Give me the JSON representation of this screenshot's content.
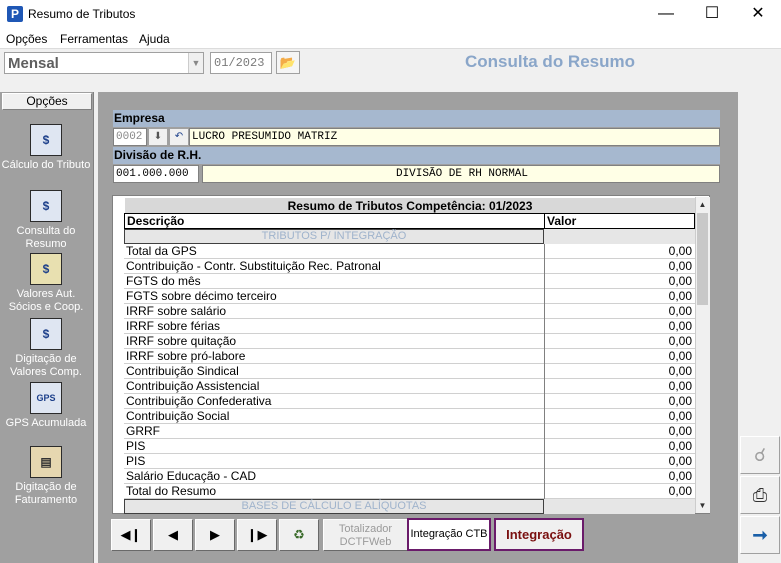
{
  "window": {
    "title": "Resumo de Tributos",
    "icon": "P"
  },
  "menu": [
    "Opções",
    "Ferramentas",
    "Ajuda"
  ],
  "toolbar": {
    "period": "Mensal",
    "competencia": "01/2023",
    "screen_title": "Consulta do Resumo"
  },
  "left_panel": {
    "header": "Opções",
    "items": [
      {
        "label": "Cálculo do Tributo",
        "icon": "calc-document-icon"
      },
      {
        "label": "Consulta do Resumo",
        "icon": "monitor-icon"
      },
      {
        "label": "Valores Aut. Sócios e Coop.",
        "icon": "people-icon"
      },
      {
        "label": "Digitação de Valores Comp.",
        "icon": "money-entry-icon"
      },
      {
        "label": "GPS Acumulada",
        "icon": "gps-icon"
      },
      {
        "label": "Digitação de Faturamento",
        "icon": "laptop-icon"
      }
    ]
  },
  "empresa": {
    "label": "Empresa",
    "code": "0002",
    "name": "LUCRO PRESUMIDO MATRIZ",
    "divisao_label": "Divisão de R.H.",
    "divisao_code": "001.000.000",
    "divisao_name": "DIVISÃO DE RH NORMAL"
  },
  "table": {
    "title": "Resumo de Tributos Competência: 01/2023",
    "col_desc": "Descrição",
    "col_valor": "Valor",
    "section1": "TRIBUTOS P/ INTEGRAÇÃO",
    "section2": "BASES DE CÁLCULO E ALÍQUOTAS",
    "rows": [
      {
        "desc": "Total da GPS",
        "valor": "0,00"
      },
      {
        "desc": "Contribuição - Contr. Substituição Rec. Patronal",
        "valor": "0,00"
      },
      {
        "desc": "FGTS do mês",
        "valor": "0,00"
      },
      {
        "desc": "FGTS sobre décimo terceiro",
        "valor": "0,00"
      },
      {
        "desc": "IRRF sobre salário",
        "valor": "0,00"
      },
      {
        "desc": "IRRF sobre férias",
        "valor": "0,00"
      },
      {
        "desc": "IRRF sobre quitação",
        "valor": "0,00"
      },
      {
        "desc": "IRRF sobre pró-labore",
        "valor": "0,00"
      },
      {
        "desc": "Contribuição Sindical",
        "valor": "0,00"
      },
      {
        "desc": "Contribuição Assistencial",
        "valor": "0,00"
      },
      {
        "desc": "Contribuição Confederativa",
        "valor": "0,00"
      },
      {
        "desc": "Contribuição Social",
        "valor": "0,00"
      },
      {
        "desc": "GRRF",
        "valor": "0,00"
      },
      {
        "desc": "PIS",
        "valor": "0,00"
      },
      {
        "desc": "PIS",
        "valor": "0,00"
      },
      {
        "desc": "Salário Educação - CAD",
        "valor": "0,00"
      },
      {
        "desc": "Total do Resumo",
        "valor": "0,00"
      }
    ]
  },
  "bottom": {
    "totalizador": "Totalizador DCTFWeb",
    "integracao_ctb": "Integração CTB",
    "integracao": "Integração"
  }
}
